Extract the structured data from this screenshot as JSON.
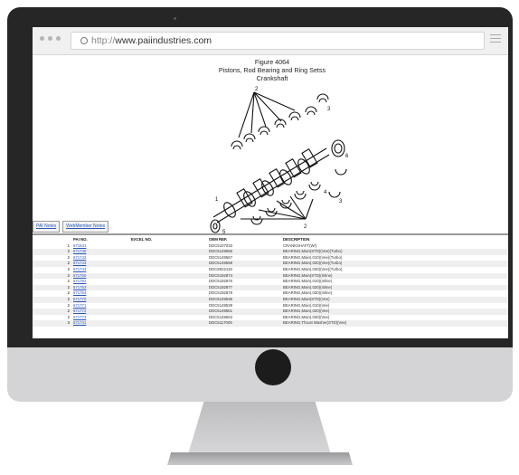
{
  "browser": {
    "url_prefix": "http://",
    "url_domain": "www.paiindustries.com"
  },
  "figure": {
    "number": "Figure 4064",
    "title": "Pistons, Rod Bearing and Ring Setss",
    "subtitle": "Crankshaft",
    "callouts": [
      "1",
      "2",
      "3",
      "5",
      "6",
      "2",
      "3",
      "4",
      "2"
    ]
  },
  "tabs": [
    "PAI Notes",
    "WebMember Notes"
  ],
  "table": {
    "headers": [
      "PAI NO.",
      "EXCEL NO.",
      "OEM REF.",
      "DESCRIPTION"
    ],
    "rows": [
      {
        "n": "1",
        "pai": "671641",
        "excel": "",
        "oem": "DDC5107033",
        "desc": "CRANKSHAFT(W/)"
      },
      {
        "n": "2",
        "pai": "671740",
        "excel": "",
        "oem": "DDC5149555",
        "desc": "BEARING,Main(STD)(Vee)(Turbo)"
      },
      {
        "n": "2",
        "pai": "671742",
        "excel": "",
        "oem": "DDC5149567",
        "desc": "BEARING,Main(.010)(Vee)(Turbo)"
      },
      {
        "n": "2",
        "pai": "671743",
        "excel": "",
        "oem": "DDC5149558",
        "desc": "BEARING,Main(.020)(Vee)(Turbo)"
      },
      {
        "n": "2",
        "pai": "671744",
        "excel": "",
        "oem": "DDC8922118",
        "desc": "BEARING,Main(.030)(Vee)(Turbo)"
      },
      {
        "n": "2",
        "pai": "671750",
        "excel": "",
        "oem": "DDC5192874",
        "desc": "BEARING,Main(STD)(Inline)"
      },
      {
        "n": "2",
        "pai": "671752",
        "excel": "",
        "oem": "DDC5192876",
        "desc": "BEARING,Main(.010)(Inline)"
      },
      {
        "n": "2",
        "pai": "671753",
        "excel": "",
        "oem": "DDC5192877",
        "desc": "BEARING,Main(.020)(Inline)"
      },
      {
        "n": "2",
        "pai": "671754",
        "excel": "",
        "oem": "DDC5192878",
        "desc": "BEARING,Main(.030)(Inline)"
      },
      {
        "n": "2",
        "pai": "671770",
        "excel": "",
        "oem": "DDC5149536",
        "desc": "BEARING,Main(STD)(Vee)"
      },
      {
        "n": "2",
        "pai": "671771",
        "excel": "",
        "oem": "DDC5149539",
        "desc": "BEARING,Main(.010)(Vee)"
      },
      {
        "n": "2",
        "pai": "671772",
        "excel": "",
        "oem": "DDC5149561",
        "desc": "BEARING,Main(.020)(Vee)"
      },
      {
        "n": "2",
        "pai": "671773",
        "excel": "",
        "oem": "DDC5149563",
        "desc": "BEARING,Main(.030)(Vee)"
      },
      {
        "n": "3",
        "pai": "671741",
        "excel": "",
        "oem": "DDC5117005",
        "desc": "BEARING,Thrust Washer(STD)(Vee)"
      }
    ]
  }
}
